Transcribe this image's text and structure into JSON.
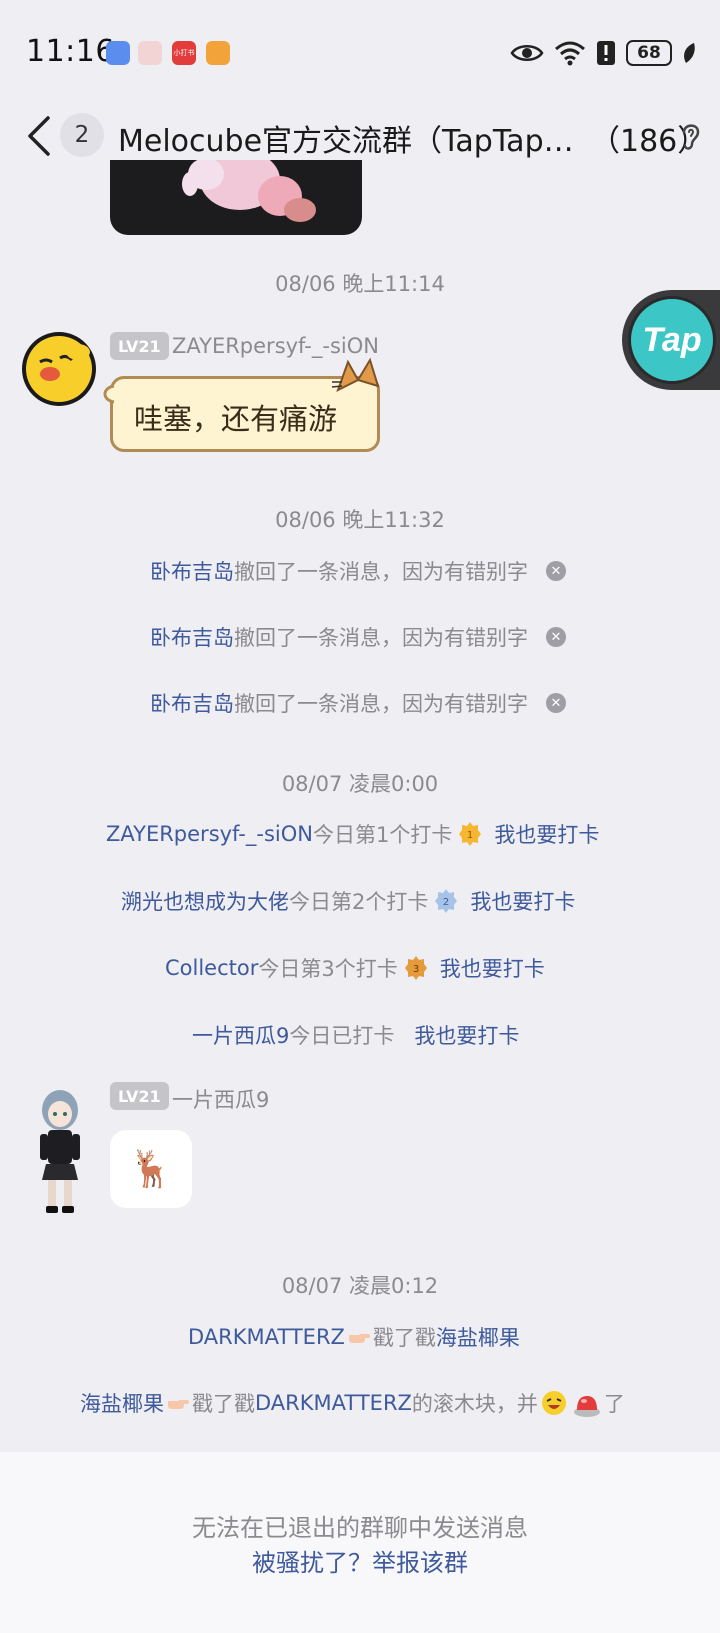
{
  "status_bar": {
    "time": "11:16",
    "battery": "68",
    "app_icons": [
      "blue-app-icon",
      "mail-app-icon",
      "red-app-icon",
      "orange-app-icon"
    ],
    "red_app_label": "小打书",
    "icons": [
      "eye-icon",
      "wifi-icon",
      "alert-icon",
      "battery-icon",
      "leaf-icon"
    ]
  },
  "header": {
    "unread_count": "2",
    "title": "Melocube官方交流群（TapTap…",
    "member_count": "（186）"
  },
  "messages": {
    "ts1": "08/06 晚上11:14",
    "msg1": {
      "level": "LV21",
      "sender": "ZAYERpersyf-_-siON",
      "text": "哇塞，还有痛游"
    },
    "ts2": "08/06 晚上11:32",
    "recalls": [
      {
        "name": "卧布吉岛",
        "text": "撤回了一条消息，因为有错别字"
      },
      {
        "name": "卧布吉岛",
        "text": "撤回了一条消息，因为有错别字"
      },
      {
        "name": "卧布吉岛",
        "text": "撤回了一条消息，因为有错别字"
      }
    ],
    "ts3": "08/07 凌晨0:00",
    "checkins": [
      {
        "name": "ZAYERpersyf-_-siON",
        "text": "今日第1个打卡",
        "medal": "1",
        "action": "我也要打卡"
      },
      {
        "name": "溯光也想成为大佬",
        "text": "今日第2个打卡",
        "medal": "2",
        "action": "我也要打卡"
      },
      {
        "name": "Collector",
        "text": "今日第3个打卡",
        "medal": "3",
        "action": "我也要打卡"
      },
      {
        "name": "一片西瓜9",
        "text": "今日已打卡",
        "medal": "",
        "action": "我也要打卡"
      }
    ],
    "msg2": {
      "level": "LV21",
      "sender": "一片西瓜9",
      "emoji": "🦌"
    },
    "ts4": "08/07 凌晨0:12",
    "poke1": {
      "from": "DARKMATTERZ",
      "verb": "戳了戳",
      "to": "海盐椰果"
    },
    "poke2": {
      "from": "海盐椰果",
      "verb": "戳了戳",
      "to": "DARKMATTERZ",
      "suffix": "的滚木块，并",
      "end": "了"
    }
  },
  "floating": {
    "label": "Tap"
  },
  "footer": {
    "notice": "无法在已退出的群聊中发送消息",
    "report": "被骚扰了？举报该群"
  },
  "colors": {
    "link": "#3e5a9c",
    "background": "#efeef3",
    "taptap": "#3dc6c6"
  }
}
